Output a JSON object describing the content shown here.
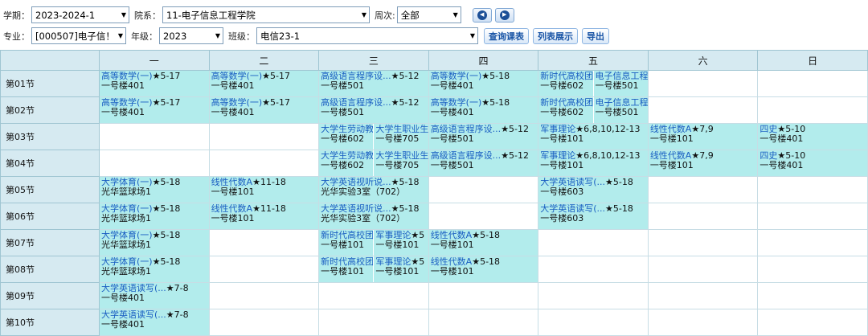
{
  "filters": {
    "term_label": "学期：",
    "term_value": "2023-2024-1",
    "dept_label": "院系：",
    "dept_value": "11-电子信息工程学院",
    "week_label": "周次:",
    "week_value": "全部",
    "major_label": "专业：",
    "major_value": "[000507]电子信！",
    "grade_label": "年级：",
    "grade_value": "2023",
    "class_label": "班级：",
    "class_value": "电信23-1",
    "query_btn": "查询课表",
    "list_btn": "列表展示",
    "export_btn": "导出"
  },
  "days": [
    "一",
    "二",
    "三",
    "四",
    "五",
    "六",
    "日"
  ],
  "periods": [
    "第01节",
    "第02节",
    "第03节",
    "第04节",
    "第05节",
    "第06节",
    "第07节",
    "第08节",
    "第09节",
    "第10节"
  ],
  "schedule": [
    [
      [
        {
          "n": "高等数学(一)",
          "w": "★5-17",
          "l": "一号楼401"
        }
      ],
      [
        {
          "n": "高等数学(一)",
          "w": "★5-17",
          "l": "一号楼401"
        }
      ],
      [
        {
          "n": "高级语言程序设...",
          "w": "★5-12",
          "l": "一号楼501"
        }
      ],
      [
        {
          "n": "高等数学(一)",
          "w": "★5-18",
          "l": "一号楼401"
        }
      ],
      [
        {
          "n": "新时代高校团",
          "w": "",
          "l": "一号楼602"
        },
        {
          "n": "电子信息工程",
          "w": "",
          "l": "一号楼501"
        }
      ],
      [],
      []
    ],
    [
      [
        {
          "n": "高等数学(一)",
          "w": "★5-17",
          "l": "一号楼401"
        }
      ],
      [
        {
          "n": "高等数学(一)",
          "w": "★5-17",
          "l": "一号楼401"
        }
      ],
      [
        {
          "n": "高级语言程序设...",
          "w": "★5-12",
          "l": "一号楼501"
        }
      ],
      [
        {
          "n": "高等数学(一)",
          "w": "★5-18",
          "l": "一号楼401"
        }
      ],
      [
        {
          "n": "新时代高校团",
          "w": "",
          "l": "一号楼602"
        },
        {
          "n": "电子信息工程",
          "w": "",
          "l": "一号楼501"
        }
      ],
      [],
      []
    ],
    [
      [],
      [],
      [
        {
          "n": "大学生劳动教",
          "w": "",
          "l": "一号楼602"
        },
        {
          "n": "大学生职业生",
          "w": "",
          "l": "一号楼705"
        }
      ],
      [
        {
          "n": "高级语言程序设...",
          "w": "★5-12",
          "l": "一号楼501"
        }
      ],
      [
        {
          "n": "军事理论",
          "w": "★6,8,10,12-13",
          "l": "一号楼101"
        }
      ],
      [
        {
          "n": "线性代数A",
          "w": "★7,9",
          "l": "一号楼101"
        }
      ],
      [
        {
          "n": "四史",
          "w": "★5-10",
          "l": "一号楼401"
        }
      ]
    ],
    [
      [],
      [],
      [
        {
          "n": "大学生劳动教",
          "w": "",
          "l": "一号楼602"
        },
        {
          "n": "大学生职业生",
          "w": "",
          "l": "一号楼705"
        }
      ],
      [
        {
          "n": "高级语言程序设...",
          "w": "★5-12",
          "l": "一号楼501"
        }
      ],
      [
        {
          "n": "军事理论",
          "w": "★6,8,10,12-13",
          "l": "一号楼101"
        }
      ],
      [
        {
          "n": "线性代数A",
          "w": "★7,9",
          "l": "一号楼101"
        }
      ],
      [
        {
          "n": "四史",
          "w": "★5-10",
          "l": "一号楼401"
        }
      ]
    ],
    [
      [
        {
          "n": "大学体育(一)",
          "w": "★5-18",
          "l": "光华篮球场1"
        }
      ],
      [
        {
          "n": "线性代数A",
          "w": "★11-18",
          "l": "一号楼101"
        }
      ],
      [
        {
          "n": "大学英语视听说...",
          "w": "★5-18",
          "l": "光华实验3室（702）"
        }
      ],
      [],
      [
        {
          "n": "大学英语读写(...",
          "w": "★5-18",
          "l": "一号楼603"
        }
      ],
      [],
      []
    ],
    [
      [
        {
          "n": "大学体育(一)",
          "w": "★5-18",
          "l": "光华篮球场1"
        }
      ],
      [
        {
          "n": "线性代数A",
          "w": "★11-18",
          "l": "一号楼101"
        }
      ],
      [
        {
          "n": "大学英语视听说...",
          "w": "★5-18",
          "l": "光华实验3室（702）"
        }
      ],
      [],
      [
        {
          "n": "大学英语读写(...",
          "w": "★5-18",
          "l": "一号楼603"
        }
      ],
      [],
      []
    ],
    [
      [
        {
          "n": "大学体育(一)",
          "w": "★5-18",
          "l": "光华篮球场1"
        }
      ],
      [],
      [
        {
          "n": "新时代高校团",
          "w": "",
          "l": "一号楼101"
        },
        {
          "n": "军事理论",
          "w": "★5",
          "l": "一号楼101"
        }
      ],
      [
        {
          "n": "线性代数A",
          "w": "★5-18",
          "l": "一号楼101"
        }
      ],
      [],
      [],
      []
    ],
    [
      [
        {
          "n": "大学体育(一)",
          "w": "★5-18",
          "l": "光华篮球场1"
        }
      ],
      [],
      [
        {
          "n": "新时代高校团",
          "w": "",
          "l": "一号楼101"
        },
        {
          "n": "军事理论",
          "w": "★5",
          "l": "一号楼101"
        }
      ],
      [
        {
          "n": "线性代数A",
          "w": "★5-18",
          "l": "一号楼101"
        }
      ],
      [],
      [],
      []
    ],
    [
      [
        {
          "n": "大学英语读写(...",
          "w": "★7-8",
          "l": "一号楼401"
        }
      ],
      [],
      [],
      [],
      [],
      [],
      []
    ],
    [
      [
        {
          "n": "大学英语读写(...",
          "w": "★7-8",
          "l": "一号楼401"
        }
      ],
      [],
      [],
      [],
      [],
      [],
      []
    ]
  ],
  "colors": {
    "cell_bg": "#b2ecec",
    "header_bg": "#d6eaf1",
    "course_name": "#1a5ec2"
  }
}
